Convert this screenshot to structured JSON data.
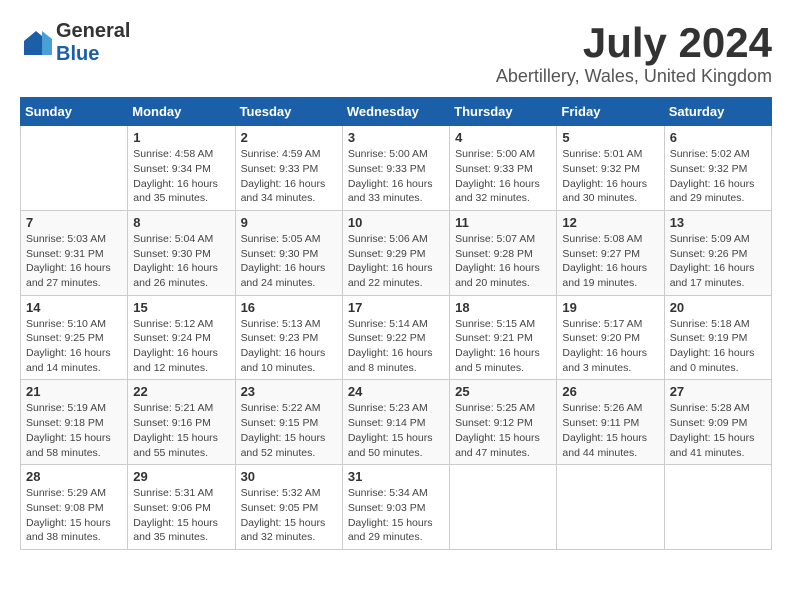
{
  "header": {
    "logo_general": "General",
    "logo_blue": "Blue",
    "month": "July 2024",
    "location": "Abertillery, Wales, United Kingdom"
  },
  "calendar": {
    "days_of_week": [
      "Sunday",
      "Monday",
      "Tuesday",
      "Wednesday",
      "Thursday",
      "Friday",
      "Saturday"
    ],
    "weeks": [
      [
        {
          "day": "",
          "info": ""
        },
        {
          "day": "1",
          "info": "Sunrise: 4:58 AM\nSunset: 9:34 PM\nDaylight: 16 hours\nand 35 minutes."
        },
        {
          "day": "2",
          "info": "Sunrise: 4:59 AM\nSunset: 9:33 PM\nDaylight: 16 hours\nand 34 minutes."
        },
        {
          "day": "3",
          "info": "Sunrise: 5:00 AM\nSunset: 9:33 PM\nDaylight: 16 hours\nand 33 minutes."
        },
        {
          "day": "4",
          "info": "Sunrise: 5:00 AM\nSunset: 9:33 PM\nDaylight: 16 hours\nand 32 minutes."
        },
        {
          "day": "5",
          "info": "Sunrise: 5:01 AM\nSunset: 9:32 PM\nDaylight: 16 hours\nand 30 minutes."
        },
        {
          "day": "6",
          "info": "Sunrise: 5:02 AM\nSunset: 9:32 PM\nDaylight: 16 hours\nand 29 minutes."
        }
      ],
      [
        {
          "day": "7",
          "info": "Sunrise: 5:03 AM\nSunset: 9:31 PM\nDaylight: 16 hours\nand 27 minutes."
        },
        {
          "day": "8",
          "info": "Sunrise: 5:04 AM\nSunset: 9:30 PM\nDaylight: 16 hours\nand 26 minutes."
        },
        {
          "day": "9",
          "info": "Sunrise: 5:05 AM\nSunset: 9:30 PM\nDaylight: 16 hours\nand 24 minutes."
        },
        {
          "day": "10",
          "info": "Sunrise: 5:06 AM\nSunset: 9:29 PM\nDaylight: 16 hours\nand 22 minutes."
        },
        {
          "day": "11",
          "info": "Sunrise: 5:07 AM\nSunset: 9:28 PM\nDaylight: 16 hours\nand 20 minutes."
        },
        {
          "day": "12",
          "info": "Sunrise: 5:08 AM\nSunset: 9:27 PM\nDaylight: 16 hours\nand 19 minutes."
        },
        {
          "day": "13",
          "info": "Sunrise: 5:09 AM\nSunset: 9:26 PM\nDaylight: 16 hours\nand 17 minutes."
        }
      ],
      [
        {
          "day": "14",
          "info": "Sunrise: 5:10 AM\nSunset: 9:25 PM\nDaylight: 16 hours\nand 14 minutes."
        },
        {
          "day": "15",
          "info": "Sunrise: 5:12 AM\nSunset: 9:24 PM\nDaylight: 16 hours\nand 12 minutes."
        },
        {
          "day": "16",
          "info": "Sunrise: 5:13 AM\nSunset: 9:23 PM\nDaylight: 16 hours\nand 10 minutes."
        },
        {
          "day": "17",
          "info": "Sunrise: 5:14 AM\nSunset: 9:22 PM\nDaylight: 16 hours\nand 8 minutes."
        },
        {
          "day": "18",
          "info": "Sunrise: 5:15 AM\nSunset: 9:21 PM\nDaylight: 16 hours\nand 5 minutes."
        },
        {
          "day": "19",
          "info": "Sunrise: 5:17 AM\nSunset: 9:20 PM\nDaylight: 16 hours\nand 3 minutes."
        },
        {
          "day": "20",
          "info": "Sunrise: 5:18 AM\nSunset: 9:19 PM\nDaylight: 16 hours\nand 0 minutes."
        }
      ],
      [
        {
          "day": "21",
          "info": "Sunrise: 5:19 AM\nSunset: 9:18 PM\nDaylight: 15 hours\nand 58 minutes."
        },
        {
          "day": "22",
          "info": "Sunrise: 5:21 AM\nSunset: 9:16 PM\nDaylight: 15 hours\nand 55 minutes."
        },
        {
          "day": "23",
          "info": "Sunrise: 5:22 AM\nSunset: 9:15 PM\nDaylight: 15 hours\nand 52 minutes."
        },
        {
          "day": "24",
          "info": "Sunrise: 5:23 AM\nSunset: 9:14 PM\nDaylight: 15 hours\nand 50 minutes."
        },
        {
          "day": "25",
          "info": "Sunrise: 5:25 AM\nSunset: 9:12 PM\nDaylight: 15 hours\nand 47 minutes."
        },
        {
          "day": "26",
          "info": "Sunrise: 5:26 AM\nSunset: 9:11 PM\nDaylight: 15 hours\nand 44 minutes."
        },
        {
          "day": "27",
          "info": "Sunrise: 5:28 AM\nSunset: 9:09 PM\nDaylight: 15 hours\nand 41 minutes."
        }
      ],
      [
        {
          "day": "28",
          "info": "Sunrise: 5:29 AM\nSunset: 9:08 PM\nDaylight: 15 hours\nand 38 minutes."
        },
        {
          "day": "29",
          "info": "Sunrise: 5:31 AM\nSunset: 9:06 PM\nDaylight: 15 hours\nand 35 minutes."
        },
        {
          "day": "30",
          "info": "Sunrise: 5:32 AM\nSunset: 9:05 PM\nDaylight: 15 hours\nand 32 minutes."
        },
        {
          "day": "31",
          "info": "Sunrise: 5:34 AM\nSunset: 9:03 PM\nDaylight: 15 hours\nand 29 minutes."
        },
        {
          "day": "",
          "info": ""
        },
        {
          "day": "",
          "info": ""
        },
        {
          "day": "",
          "info": ""
        }
      ]
    ]
  }
}
